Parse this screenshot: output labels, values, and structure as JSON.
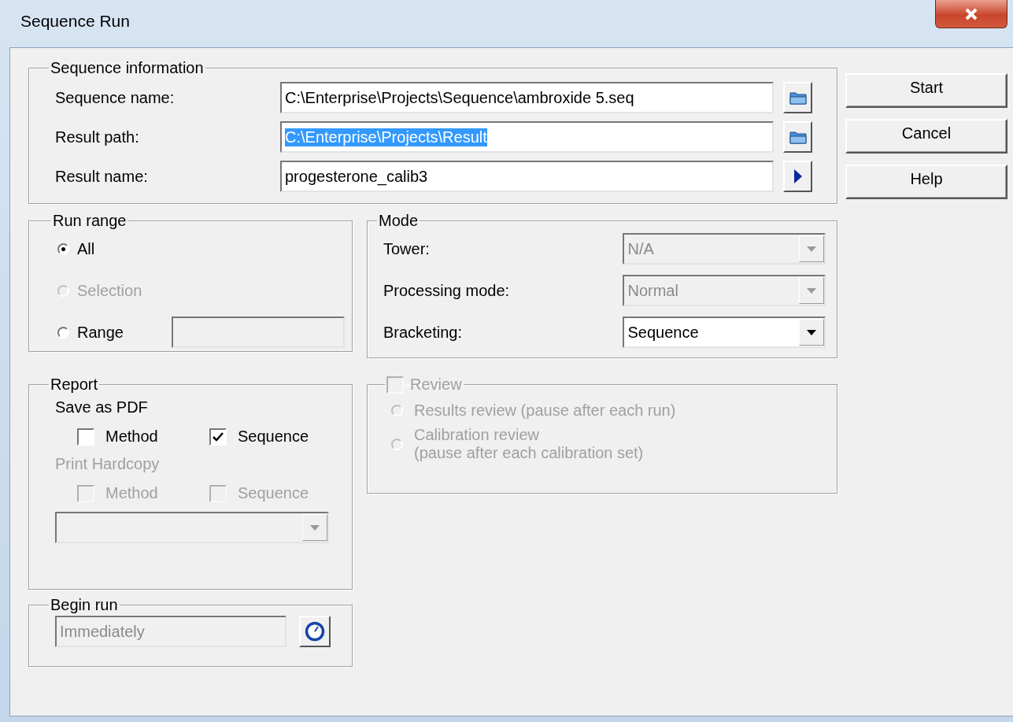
{
  "window": {
    "title": "Sequence Run"
  },
  "sequence_information": {
    "title": "Sequence information",
    "fields": [
      {
        "label": "Sequence name:",
        "value": "C:\\Enterprise\\Projects\\Sequence\\ambroxide 5.seq",
        "selected": false,
        "kind": "browse"
      },
      {
        "label": "Result path:",
        "value": "C:\\Enterprise\\Projects\\Result",
        "selected": true,
        "kind": "browse"
      },
      {
        "label": "Result name:",
        "value": "progesterone_calib3",
        "selected": false,
        "kind": "arrow"
      }
    ]
  },
  "run_range": {
    "title": "Run range",
    "options": [
      {
        "label": "All",
        "selected": true,
        "disabled": false,
        "kind": "plain"
      },
      {
        "label": "Selection",
        "selected": false,
        "disabled": true,
        "kind": "plain"
      },
      {
        "label": "Range",
        "selected": false,
        "disabled": false,
        "kind": "field",
        "field_disabled": true
      }
    ]
  },
  "mode": {
    "title": "Mode",
    "fields": [
      {
        "label": "Tower:",
        "value": "N/A",
        "disabled": true
      },
      {
        "label": "Processing mode:",
        "value": "Normal",
        "disabled": true
      },
      {
        "label": "Bracketing:",
        "value": "Sequence",
        "disabled": false
      }
    ]
  },
  "report": {
    "title": "Report",
    "sections": [
      {
        "label": "Save as PDF",
        "disabled": false,
        "options": [
          {
            "label": "Method",
            "checked": false
          },
          {
            "label": "Sequence",
            "checked": true
          }
        ]
      },
      {
        "label": "Print Hardcopy",
        "disabled": true,
        "options": [
          {
            "label": "Method",
            "checked": false
          },
          {
            "label": "Sequence",
            "checked": false
          }
        ]
      }
    ],
    "printer": {
      "disabled": true
    }
  },
  "review": {
    "title": "Review",
    "checked": false,
    "disabled": true,
    "options": [
      {
        "lines": [
          "Results review (pause after each run)"
        ],
        "selected": false
      },
      {
        "lines": [
          "Calibration review",
          "(pause after each calibration set)"
        ],
        "selected": false
      }
    ]
  },
  "begin_run": {
    "title": "Begin run",
    "value": "Immediately",
    "disabled": true
  },
  "buttons": [
    {
      "label": "Start"
    },
    {
      "label": "Cancel"
    },
    {
      "label": "Help"
    }
  ]
}
